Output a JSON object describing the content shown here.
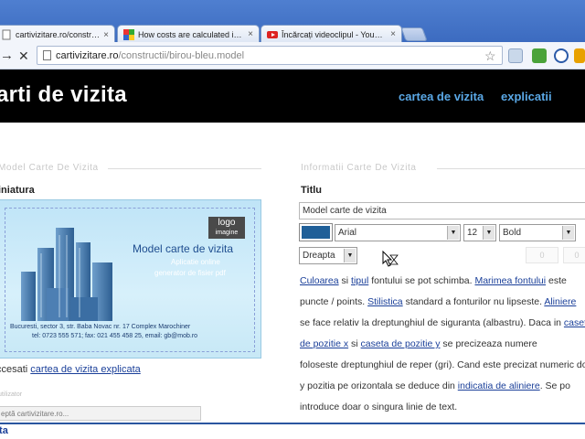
{
  "browser": {
    "tabs": [
      {
        "title": "cartivizitare.ro/constructi/bi",
        "favicon": "page-icon",
        "active": true
      },
      {
        "title": "How costs are calculated in A",
        "favicon": "google-icon",
        "active": false
      },
      {
        "title": "Încărcați videoclipul - YouTub",
        "favicon": "youtube-icon",
        "active": false
      }
    ],
    "tab_close": "×",
    "url_host": "cartivizitare.ro",
    "url_path": "/constructii/birou-bleu.model",
    "back_glyph": "→",
    "stop_glyph": "✕",
    "star_glyph": "☆"
  },
  "site": {
    "title": "arti de vizita",
    "nav": [
      "cartea de vizita",
      "explicatii"
    ]
  },
  "left": {
    "legend": "Model Carte De Vizita",
    "heading": "iniatura",
    "card": {
      "logo_top": "logo",
      "logo_bottom": "imagine",
      "title": "Model carte de vizita",
      "line1": "Aplicatie online",
      "line2": "generator de fisier pdf",
      "address": "Bucuresti, sector 3, str. Baba Novac nr. 17 Complex Marochiner",
      "contact": "tel: 0723 555 571; fax: 021 455 458 25, email: gb@mob.ro"
    },
    "access_prefix": "ccesati ",
    "access_link": "cartea de vizita explicata",
    "small_label": "utilizator",
    "status_text": "eptă cartivizitare.ro..."
  },
  "right": {
    "legend": "Informatii Carte De Vizita",
    "heading": "Titlu",
    "title_value": "Model carte de vizita",
    "font_select": "Arial",
    "size_select": "12",
    "weight_select": "Bold",
    "align_select": "Dreapta",
    "ghost_inputs": [
      "0",
      "0"
    ],
    "paragraph": [
      [
        {
          "t": "Culoarea",
          "l": true
        },
        {
          "t": " si "
        },
        {
          "t": "tipul",
          "l": true
        },
        {
          "t": " fontului se pot schimba. "
        },
        {
          "t": "Marimea fontului",
          "l": true
        },
        {
          "t": " este"
        }
      ],
      [
        {
          "t": "puncte / points. "
        },
        {
          "t": "Stilistica",
          "l": true
        },
        {
          "t": " standard a fonturilor nu lipseste. "
        },
        {
          "t": "Aliniere",
          "l": true
        }
      ],
      [
        {
          "t": "se face relativ la dreptunghiul de siguranta (albastru). Daca in "
        },
        {
          "t": "caseta",
          "l": true
        }
      ],
      [
        {
          "t": "de pozitie x",
          "l": true
        },
        {
          "t": " si "
        },
        {
          "t": "caseta de pozitie y",
          "l": true
        },
        {
          "t": " se precizeaza numere"
        }
      ],
      [
        {
          "t": "foloseste dreptunghiul de reper (gri). Cand este precizat numeric do"
        }
      ],
      [
        {
          "t": "y pozitia pe orizontala se deduce din "
        },
        {
          "t": "indicatia de aliniere",
          "l": true
        },
        {
          "t": ". Se po"
        }
      ],
      [
        {
          "t": "introduce doar o singura linie de text."
        }
      ]
    ]
  },
  "bottom": {
    "text": "ita"
  },
  "colors": {
    "header_bg": "#000000",
    "nav_link": "#5aa8e6",
    "link": "#1a3f99",
    "swatch": "#1f5f98"
  }
}
